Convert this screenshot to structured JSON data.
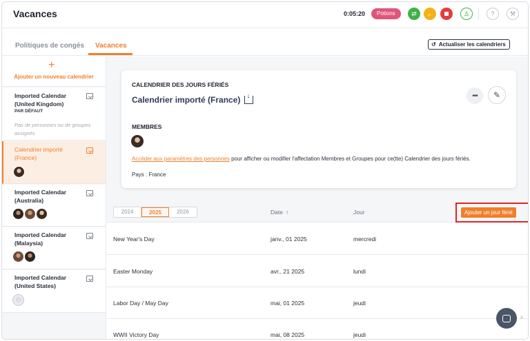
{
  "header": {
    "title": "Vacances",
    "timer": "0:05:20",
    "potions_label": "Potions"
  },
  "tabs": [
    {
      "label": "Politiques de congés"
    },
    {
      "label": "Vacances"
    }
  ],
  "refresh_label": "Actualiser les calendriers",
  "sidebar": {
    "add_label": "Ajouter un nouveau calendrier",
    "calendars": [
      {
        "name": "Imported Calendar (United Kingdom)",
        "tag": "PAR DÉFAUT",
        "empty_text": "Pas de personnes ou de groupes assignés"
      },
      {
        "name": "Calendrier importé (France)"
      },
      {
        "name": "Imported Calendar (Australia)"
      },
      {
        "name": "Imported Calendar (Malaysia)"
      },
      {
        "name": "Imported Calendar (United States)"
      }
    ]
  },
  "card": {
    "title": "CALENDRIER DES JOURS FÉRIÉS",
    "subtitle": "Calendrier importé (France)",
    "more": "•••",
    "members_label": "MEMBRES",
    "link_text": "Accéder aux paramètres des personnes",
    "rest_text": " pour afficher ou modifier l'affectation Membres et Groupes pour ce(tte) Calendrier des jours fériés.",
    "country": "Pays : France"
  },
  "table": {
    "years": [
      "2024",
      "2025",
      "2026"
    ],
    "selected_year": "2025",
    "col_date": "Date",
    "col_day": "Jour",
    "add_button": "Ajouter un jour férié",
    "rows": [
      {
        "name": "New Year's Day",
        "date": "janv., 01 2025",
        "day": "mercredi"
      },
      {
        "name": "Easter Monday",
        "date": "avr., 21 2025",
        "day": "lundi"
      },
      {
        "name": "Labor Day / May Day",
        "date": "mai, 01 2025",
        "day": "jeudi"
      },
      {
        "name": "WWII Victory Day",
        "date": "mai, 08 2025",
        "day": "jeudi"
      }
    ]
  },
  "colors": {
    "accent": "#f07f2b",
    "potions": "#e0567a",
    "highlight": "#e02424"
  }
}
